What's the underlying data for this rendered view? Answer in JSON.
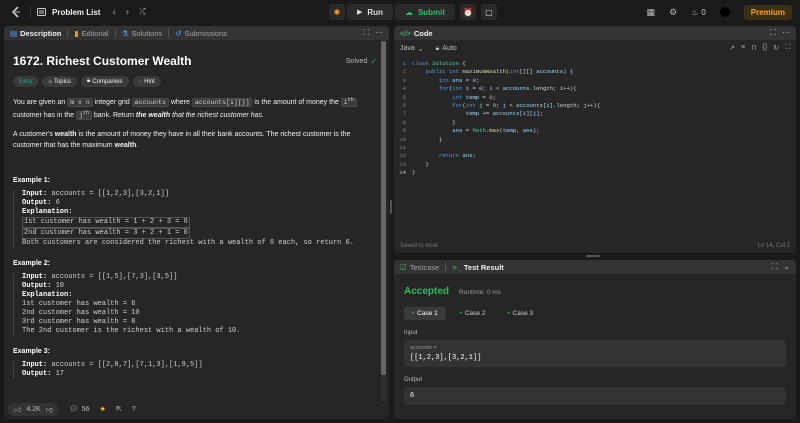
{
  "topnav": {
    "problem_list": "Problem List",
    "run": "Run",
    "submit": "Submit",
    "streak": "0",
    "premium": "Premium"
  },
  "left_tabs": {
    "description": "Description",
    "editorial": "Editorial",
    "solutions": "Solutions",
    "submissions": "Submissions"
  },
  "problem": {
    "title": "1672. Richest Customer Wealth",
    "status": "Solved",
    "chips": {
      "difficulty": "Easy",
      "topics": "Topics",
      "companies": "Companies",
      "hint": "Hint"
    },
    "p1_a": "You are given an ",
    "p1_code1": "m x n",
    "p1_b": " integer grid ",
    "p1_code2": "accounts",
    "p1_c": " where ",
    "p1_code3": "accounts[i][j]",
    "p1_d": " is the amount of money the ",
    "p1_i": "i",
    "p1_th1": "th",
    "p1_e": " customer has in the ",
    "p1_j": "j",
    "p1_th2": "th",
    "p1_f": " bank. Return ",
    "p1_g": "the wealth",
    "p1_h": " that the richest customer has.",
    "p2_a": "A customer's ",
    "p2_b": "wealth",
    "p2_c": " is the amount of money they have in all their bank accounts. The richest customer is the customer that has the maximum ",
    "p2_d": "wealth",
    "p2_e": ".",
    "examples": [
      {
        "title": "Example 1:",
        "input_label": "Input:",
        "input": " accounts = [[1,2,3],[3,2,1]]",
        "output_label": "Output:",
        "output": " 6",
        "expl_label": "Explanation:",
        "lines": [
          "1st customer has wealth = 1 + 2 + 3 = 6",
          "2nd customer has wealth = 3 + 2 + 1 = 6",
          "Both customers are considered the richest with a wealth of 6 each, so return 6."
        ]
      },
      {
        "title": "Example 2:",
        "input_label": "Input:",
        "input": " accounts = [[1,5],[7,3],[3,5]]",
        "output_label": "Output:",
        "output": " 10",
        "expl_label": "Explanation:",
        "lines": [
          "1st customer has wealth = 6",
          "2nd customer has wealth = 10",
          "3rd customer has wealth = 8",
          "The 2nd customer is the richest with a wealth of 10."
        ]
      },
      {
        "title": "Example 3:",
        "input_label": "Input:",
        "input": " accounts = [[2,8,7],[7,1,3],[1,9,5]]",
        "output_label": "Output:",
        "output": " 17"
      }
    ]
  },
  "bottom_bar": {
    "likes": "4.2K",
    "comments": "56"
  },
  "code": {
    "tab": "Code",
    "language": "Java",
    "mode": "Auto",
    "saved": "Saved to local",
    "position": "Ln 14, Col 2",
    "lines": [
      "class Solution {",
      "    public int maximumWealth(int[][] accounts) {",
      "        int ans = 0;",
      "        for(int i = 0; i < accounts.length; i++){",
      "            int temp = 0;",
      "            for(int j = 0; j < accounts[i].length; j++){",
      "                temp += accounts[i][j];",
      "            }",
      "            ans = Math.max(temp, ans);",
      "        }",
      "",
      "        return ans;",
      "    }",
      "}"
    ]
  },
  "result": {
    "testcase_tab": "Testcase",
    "result_tab": "Test Result",
    "status": "Accepted",
    "runtime": "Runtime: 0 ms",
    "cases": [
      "Case 1",
      "Case 2",
      "Case 3"
    ],
    "input_label": "Input",
    "var_name": "accounts =",
    "input_value": "[[1,2,3],[3,2,1]]",
    "output_label": "Output",
    "output_value": "6"
  }
}
